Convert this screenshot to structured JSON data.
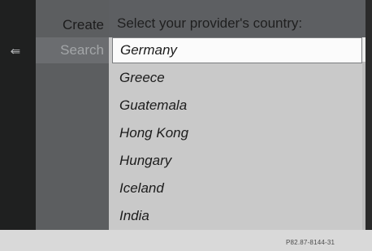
{
  "menu": {
    "create_label": "Create",
    "search_label": "Search",
    "back_icon": "back-arrow-icon"
  },
  "header": {
    "title": "Select your provider's country:"
  },
  "countries": [
    "Germany",
    "Greece",
    "Guatemala",
    "Hong Kong",
    "Hungary",
    "Iceland",
    "India"
  ],
  "selected_country": "Germany",
  "footer": {
    "reference": "P82.87-8144-31"
  }
}
